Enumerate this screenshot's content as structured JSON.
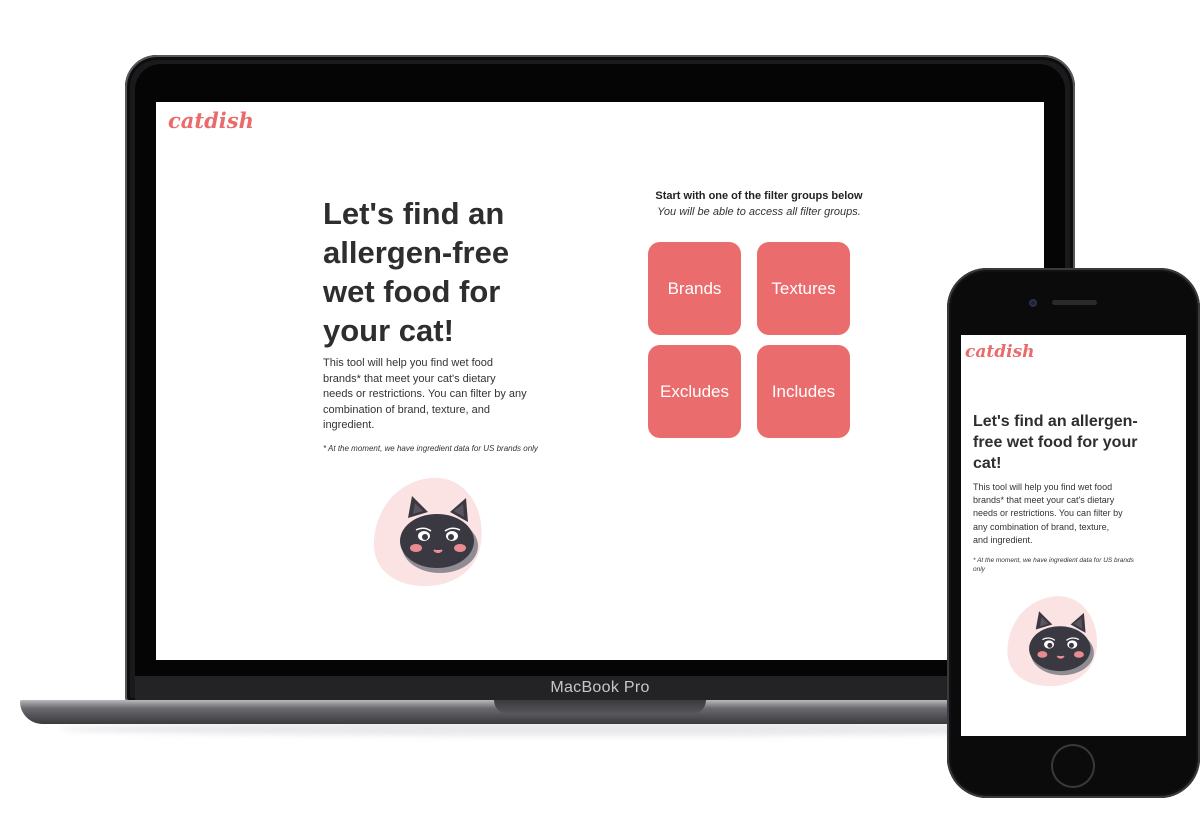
{
  "app": {
    "logo": "catdish",
    "headline": "Let's find an allergen-free wet food for your cat!",
    "headline_lines_desktop": [
      "Let's find an",
      "allergen-free",
      "wet food for",
      "your cat!"
    ],
    "headline_lines_mobile": [
      "Let's find an allergen-",
      "free wet food for your",
      "cat!"
    ],
    "description_lines_desktop": [
      "This tool will help you find wet food",
      "brands* that meet your cat's dietary",
      "needs or restrictions. You can filter by any",
      "combination of brand, texture, and",
      "ingredient."
    ],
    "description_lines_mobile": [
      "This tool will help you find wet food",
      "brands* that meet your cat's dietary",
      "needs or restrictions. You can filter by",
      "any combination of brand, texture,",
      "and ingredient."
    ],
    "footnote": "* At the moment, we have ingredient data for US brands only",
    "footnote_lines_mobile": [
      "* At the moment, we have ingredient data for US brands",
      "only"
    ],
    "filter_heading": "Start with one of the filter groups below",
    "filter_subheading": "You will be able to access all filter groups.",
    "filters": [
      "Brands",
      "Textures",
      "Excludes",
      "Includes"
    ]
  },
  "device": {
    "laptop_label": "MacBook Pro"
  },
  "colors": {
    "accent": "#eb6c6c",
    "blob": "#fbe3e4",
    "text": "#2e2e2e"
  },
  "icons": {
    "mascot": "cat-face-icon"
  }
}
